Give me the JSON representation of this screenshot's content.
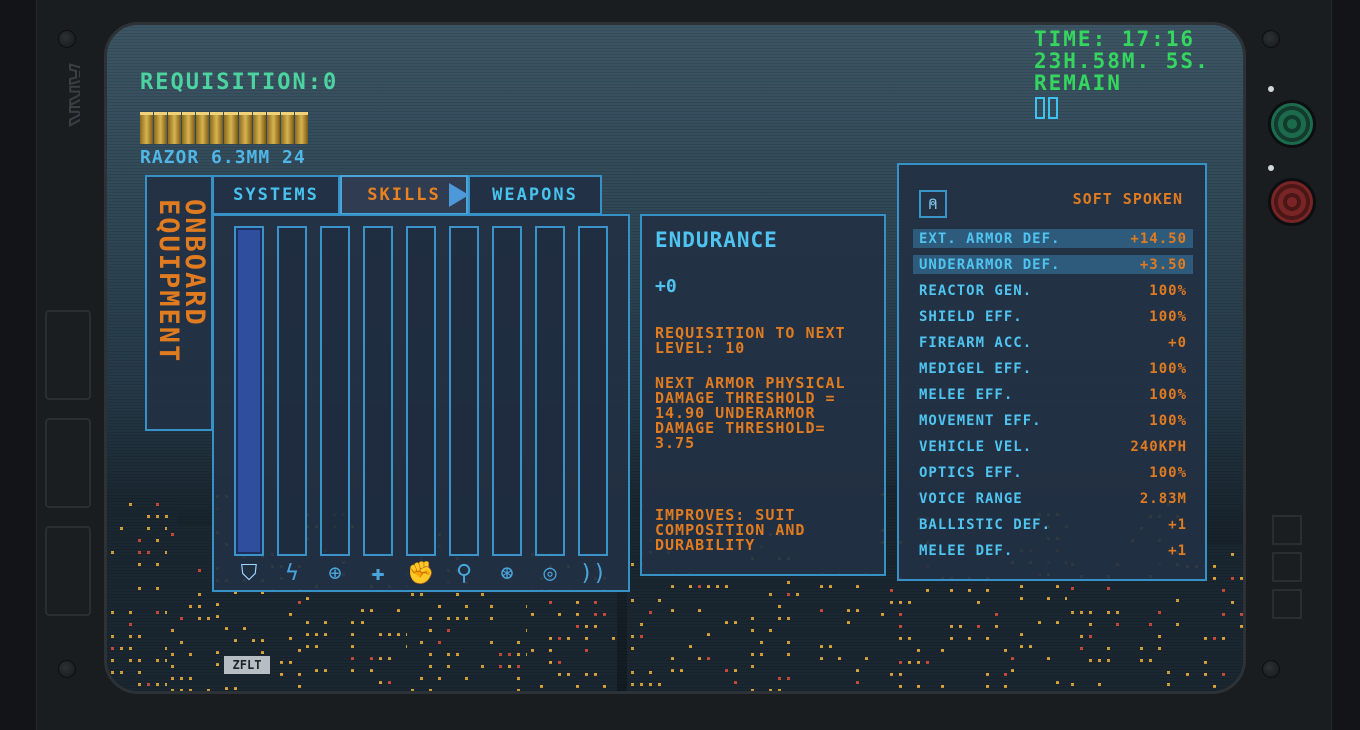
{
  "hud": {
    "requisition": "REQUISITION:0",
    "ammo_label": "RAZOR 6.3MM 24",
    "ammo_count": 12,
    "time_line1": "TIME: 17:16",
    "time_line2": "23H.58M. 5S.",
    "time_line3": "REMAIN",
    "bezel_logo": "ARK",
    "sticker_text": "ZFLT"
  },
  "equipment_tab": {
    "label": "ONBOARD EQUIPMENT"
  },
  "tabs": [
    {
      "label": "SYSTEMS",
      "active": false
    },
    {
      "label": "SKILLS",
      "active": true
    },
    {
      "label": "WEAPONS",
      "active": false
    }
  ],
  "skills": {
    "selected_index": 0,
    "icons": [
      "shield-icon",
      "lightning-arrow-icon",
      "crosshair-icon",
      "medical-cross-icon",
      "melee-fist-icon",
      "running-icon",
      "steering-wheel-icon",
      "eye-icon",
      "voice-waves-icon"
    ]
  },
  "detail": {
    "title": "ENDURANCE",
    "value": "+0",
    "requisition": "REQUISITION TO NEXT LEVEL: 10",
    "next": "NEXT ARMOR PHYSICAL DAMAGE THRESHOLD = 14.90 UNDERARMOR DAMAGE THRESHOLD= 3.75",
    "improves": "IMPROVES: SUIT COMPOSITION AND DURABILITY"
  },
  "stats": {
    "perk": "SOFT SPOKEN",
    "rows": [
      {
        "label": "EXT. ARMOR DEF.",
        "value": "+14.50",
        "highlight": true
      },
      {
        "label": "UNDERARMOR DEF.",
        "value": "+3.50",
        "highlight": true
      },
      {
        "label": "REACTOR GEN.",
        "value": "100%"
      },
      {
        "label": "SHIELD EFF.",
        "value": "100%"
      },
      {
        "label": "FIREARM ACC.",
        "value": "+0"
      },
      {
        "label": "MEDIGEL EFF.",
        "value": "100%"
      },
      {
        "label": "MELEE EFF.",
        "value": "100%"
      },
      {
        "label": "MOVEMENT EFF.",
        "value": "100%"
      },
      {
        "label": "VEHICLE VEL.",
        "value": "240KPH"
      },
      {
        "label": "OPTICS EFF.",
        "value": "100%"
      },
      {
        "label": "VOICE RANGE",
        "value": "2.83M"
      },
      {
        "label": "BALLISTIC DEF.",
        "value": "+1"
      },
      {
        "label": "MELEE DEF.",
        "value": "+1"
      }
    ]
  },
  "colors": {
    "accent_blue": "#3591c6",
    "orange": "#e07b20",
    "green": "#35d65e",
    "cyan": "#4fc4f0"
  }
}
